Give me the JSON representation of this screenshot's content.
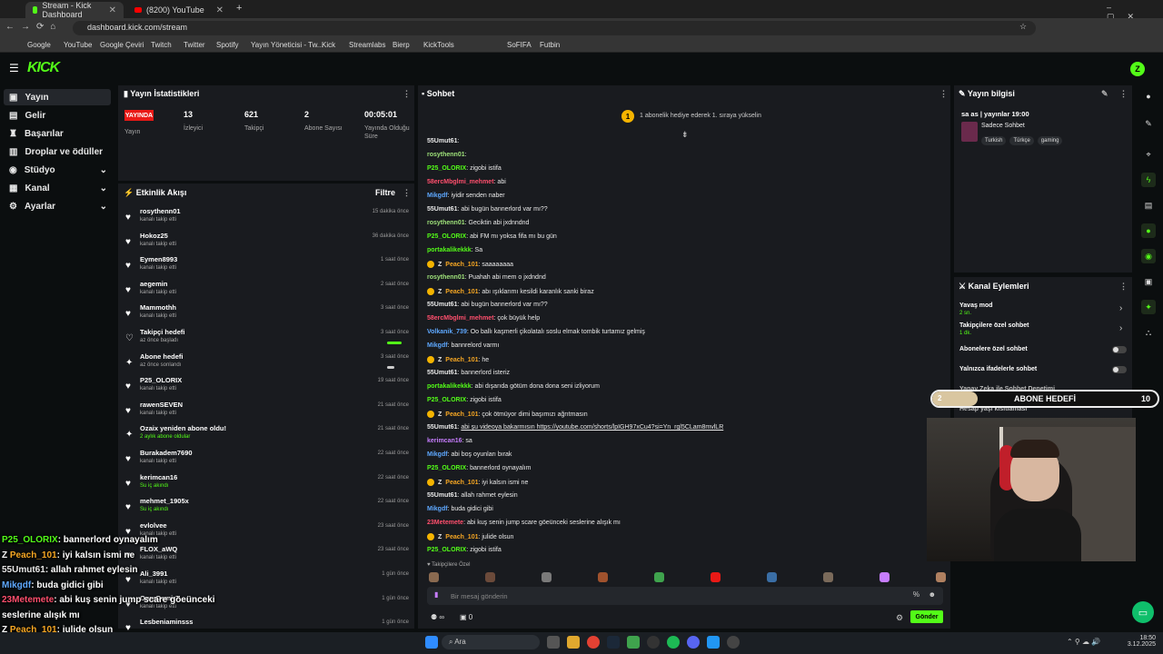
{
  "browser": {
    "tabs": [
      {
        "title": "Stream - Kick Dashboard",
        "active": true
      },
      {
        "title": "(8200) YouTube",
        "active": false
      }
    ],
    "url": "dashboard.kick.com/stream",
    "bookmarks": [
      "Google",
      "YouTube",
      "Google Çeviri",
      "Twitch",
      "Twitter",
      "Spotify",
      "Yayın Yöneticisi - Tw...",
      "Kick",
      "Streamlabs",
      "Bierp",
      "KickTools",
      "SoFIFA",
      "Futbin"
    ]
  },
  "app": {
    "logo": "KICK",
    "accent": "#53fc18"
  },
  "sidebar": {
    "items": [
      {
        "label": "Yayın",
        "icon": "video-icon",
        "active": true,
        "expandable": false
      },
      {
        "label": "Gelir",
        "icon": "wallet-icon",
        "active": false,
        "expandable": false
      },
      {
        "label": "Başarılar",
        "icon": "trophy-icon",
        "active": false,
        "expandable": false
      },
      {
        "label": "Droplar ve ödüller",
        "icon": "gift-icon",
        "active": false,
        "expandable": false
      },
      {
        "label": "Stüdyo",
        "icon": "camera-icon",
        "active": false,
        "expandable": true
      },
      {
        "label": "Kanal",
        "icon": "channel-icon",
        "active": false,
        "expandable": true
      },
      {
        "label": "Ayarlar",
        "icon": "gear-icon",
        "active": false,
        "expandable": true
      }
    ]
  },
  "stats": {
    "title": "Yayın İstatistikleri",
    "live_badge": "YAYINDA",
    "live_label": "Yayın",
    "items": [
      {
        "value": "13",
        "label": "İzleyici"
      },
      {
        "value": "621",
        "label": "Takipçi"
      },
      {
        "value": "2",
        "label": "Abone Sayısı"
      },
      {
        "value": "00:05:01",
        "label": "Yayında Olduğu Süre"
      }
    ]
  },
  "activity": {
    "title": "Etkinlik Akışı",
    "filter": "Filtre",
    "events": [
      {
        "name": "rosythenn01",
        "sub": "kanalı takip etti",
        "time": "15 dakika önce"
      },
      {
        "name": "Hokoz25",
        "sub": "kanalı takip etti",
        "time": "36 dakika önce"
      },
      {
        "name": "Eymen8993",
        "sub": "kanalı takip etti",
        "time": "1 saat önce"
      },
      {
        "name": "aegemin",
        "sub": "kanalı takip etti",
        "time": "2 saat önce"
      },
      {
        "name": "Mammothh",
        "sub": "kanalı takip etti",
        "time": "3 saat önce"
      },
      {
        "name": "Takipçi hedefi",
        "sub": "az önce başladı",
        "time": "3 saat önce"
      },
      {
        "name": "Abone hedefi",
        "sub": "az önce sonlandı",
        "time": "3 saat önce"
      },
      {
        "name": "P25_OLORIX",
        "sub": "kanalı takip etti",
        "time": "19 saat önce"
      },
      {
        "name": "rawenSEVEN",
        "sub": "kanalı takip etti",
        "time": "21 saat önce"
      },
      {
        "name": "Ozaix yeniden abone oldu!",
        "sub": "2 aylık abone oldular",
        "time": "21 saat önce"
      },
      {
        "name": "Burakadem7690",
        "sub": "kanalı takip etti",
        "time": "22 saat önce"
      },
      {
        "name": "kerimcan16",
        "sub": "Su iç akındı",
        "time": "22 saat önce"
      },
      {
        "name": "mehmet_1905x",
        "sub": "Su iç akındı",
        "time": "22 saat önce"
      },
      {
        "name": "evlolvee",
        "sub": "kanalı takip etti",
        "time": "23 saat önce"
      },
      {
        "name": "FLOX_aWQ",
        "sub": "kanalı takip etti",
        "time": "23 saat önce"
      },
      {
        "name": "Ali_3991",
        "sub": "kanalı takip etti",
        "time": "1 gün önce"
      },
      {
        "name": "OnurDemir7",
        "sub": "kanalı takip etti",
        "time": "1 gün önce"
      },
      {
        "name": "Lesbeniaminsss",
        "sub": "",
        "time": "1 gün önce"
      }
    ]
  },
  "chat": {
    "title": "Sohbet",
    "pinned": "1 abonelik hediye ederek 1. sıraya yükselin",
    "messages": [
      {
        "user": "55Umut61",
        "text": "",
        "color": "#e8e8e8",
        "badge": false
      },
      {
        "user": "rosythenn01",
        "text": "",
        "color": "#9fe27a",
        "badge": false
      },
      {
        "user": "P25_OLORIX",
        "text": "zigobi istifa",
        "color": "#53fc18",
        "badge": false
      },
      {
        "user": "58ercMbglmi_mehmet",
        "text": "abi",
        "color": "#ff4f6d",
        "badge": false
      },
      {
        "user": "Mikgdf",
        "text": "iyidir senden naber",
        "color": "#5ea8ff",
        "badge": false
      },
      {
        "user": "55Umut61",
        "text": "abi bugün bannerlord var mı??",
        "color": "#e8e8e8",
        "badge": false
      },
      {
        "user": "rosythenn01",
        "text": "Geciktin abi jxdnndnd",
        "color": "#9fe27a",
        "badge": false
      },
      {
        "user": "P25_OLORIX",
        "text": "abi FM mı yoksa fifa mı bu gün",
        "color": "#53fc18",
        "badge": false
      },
      {
        "user": "portakalikekkk",
        "text": "Sa",
        "color": "#53fc18",
        "badge": false
      },
      {
        "user": "Peach_101",
        "text": "saaaaaaaa",
        "color": "#f5a623",
        "badge": true
      },
      {
        "user": "rosythenn01",
        "text": "Puahah abi mem o jxdndnd",
        "color": "#9fe27a",
        "badge": false
      },
      {
        "user": "Peach_101",
        "text": "abı ışıklarımı kesildi karanlık sanki biraz",
        "color": "#f5a623",
        "badge": true
      },
      {
        "user": "55Umut61",
        "text": "abi bugün bannerlord var mı??",
        "color": "#e8e8e8",
        "badge": false
      },
      {
        "user": "58ercMbglmi_mehmet",
        "text": "çok büyük help",
        "color": "#ff4f6d",
        "badge": false
      },
      {
        "user": "Volkanik_739",
        "text": "Oo ballı kaşmerli çikolatalı soslu elmak tombik turtamız gelmiş",
        "color": "#5ea8ff",
        "badge": false
      },
      {
        "user": "Mikgdf",
        "text": "bannrelord varmı",
        "color": "#5ea8ff",
        "badge": false
      },
      {
        "user": "Peach_101",
        "text": "he",
        "color": "#f5a623",
        "badge": true
      },
      {
        "user": "55Umut61",
        "text": "bannerlord isteriz",
        "color": "#e8e8e8",
        "badge": false
      },
      {
        "user": "portakalikekkk",
        "text": "abi dışarıda götüm dona dona seni izliyorum",
        "color": "#53fc18",
        "badge": false
      },
      {
        "user": "P25_OLORIX",
        "text": "zigobi istifa",
        "color": "#53fc18",
        "badge": false
      },
      {
        "user": "Peach_101",
        "text": "çok ötmüyor dimi başımızı ağrıtmasın",
        "color": "#f5a623",
        "badge": true
      },
      {
        "user": "55Umut61",
        "text": "abi şu videoya bakarmısın https://youtube.com/shorts/lpIGH97xCu4?si=Yn_rgl5CLam8mvlLR",
        "color": "#e8e8e8",
        "badge": false
      },
      {
        "user": "kerimcan16",
        "text": "sa",
        "color": "#c77dff",
        "badge": false
      },
      {
        "user": "Mikgdf",
        "text": "abi boş oyunları bırak",
        "color": "#5ea8ff",
        "badge": false
      },
      {
        "user": "P25_OLORIX",
        "text": "bannerlord oynayalım",
        "color": "#53fc18",
        "badge": false
      },
      {
        "user": "Peach_101",
        "text": "iyi kalsın ismi ne",
        "color": "#f5a623",
        "badge": true
      },
      {
        "user": "55Umut61",
        "text": "allah rahmet eylesin",
        "color": "#e8e8e8",
        "badge": false
      },
      {
        "user": "Mikgdf",
        "text": "buda gidici gibi",
        "color": "#5ea8ff",
        "badge": false
      },
      {
        "user": "23Metemete",
        "text": "abi kuş senin jump scare göeünceki seslerine alışık mı",
        "color": "#ff4f6d",
        "badge": false
      },
      {
        "user": "Peach_101",
        "text": "julide olsun",
        "color": "#f5a623",
        "badge": true
      },
      {
        "user": "P25_OLORIX",
        "text": "zigobi istifa",
        "color": "#53fc18",
        "badge": false
      }
    ],
    "followers_only": "Takipçilere Özel",
    "input_placeholder": "Bir mesaj gönderin",
    "points": "0",
    "send": "Gönder"
  },
  "stream_info": {
    "title": "Yayın bilgisi",
    "stream_title": "sa as | yayınlar 19:00",
    "category": "Sadece Sohbet",
    "tags": [
      "Turkish",
      "Türkçe",
      "gaming"
    ]
  },
  "channel_actions": {
    "title": "Kanal Eylemleri",
    "items": [
      {
        "label": "Yavaş mod",
        "sub": "2 sn.",
        "type": "arrow"
      },
      {
        "label": "Takipçilere özel sohbet",
        "sub": "1 dk.",
        "type": "arrow"
      },
      {
        "label": "Abonelere özel sohbet",
        "sub": "",
        "type": "toggle"
      },
      {
        "label": "Yalnızca ifadelerle sohbet",
        "sub": "",
        "type": "toggle"
      },
      {
        "label": "Yapay Zeka ile Sohbet Denetimi",
        "sub": "",
        "type": "toggle"
      },
      {
        "label": "Hesap yaşı kısıtlaması",
        "sub": "",
        "type": "arrow"
      }
    ]
  },
  "sub_goal": {
    "label": "ABONE HEDEFİ",
    "current": "2",
    "target": "10",
    "progress": 0.2
  },
  "overlay_chat": [
    {
      "user": "P25_OLORIX",
      "text": ": bannerlord oynayalım",
      "color": "#53fc18",
      "badge": false
    },
    {
      "user": "Peach_101",
      "text": ": iyi kalsın ismi ne",
      "color": "#f5a623",
      "badge": true
    },
    {
      "user": "55Umut61",
      "text": ": allah rahmet eylesin",
      "color": "#e8e8e8",
      "badge": false
    },
    {
      "user": "Mikgdf",
      "text": ": buda gidici gibi",
      "color": "#5ea8ff",
      "badge": false
    },
    {
      "user": "23Metemete",
      "text": ": abi kuş senin jump scare göeünceki",
      "color": "#ff4f6d",
      "badge": false
    },
    {
      "user": "",
      "text": "seslerine alışık mı",
      "color": "#fff",
      "badge": false
    },
    {
      "user": "Peach_101",
      "text": ": julide olsun",
      "color": "#f5a623",
      "badge": true
    },
    {
      "user": "P25_OLORIX",
      "text": ": zigobi istifa",
      "color": "#53fc18",
      "badge": false
    }
  ],
  "taskbar": {
    "search": "Ara",
    "time": "18:50",
    "date": "3.12.2025"
  }
}
